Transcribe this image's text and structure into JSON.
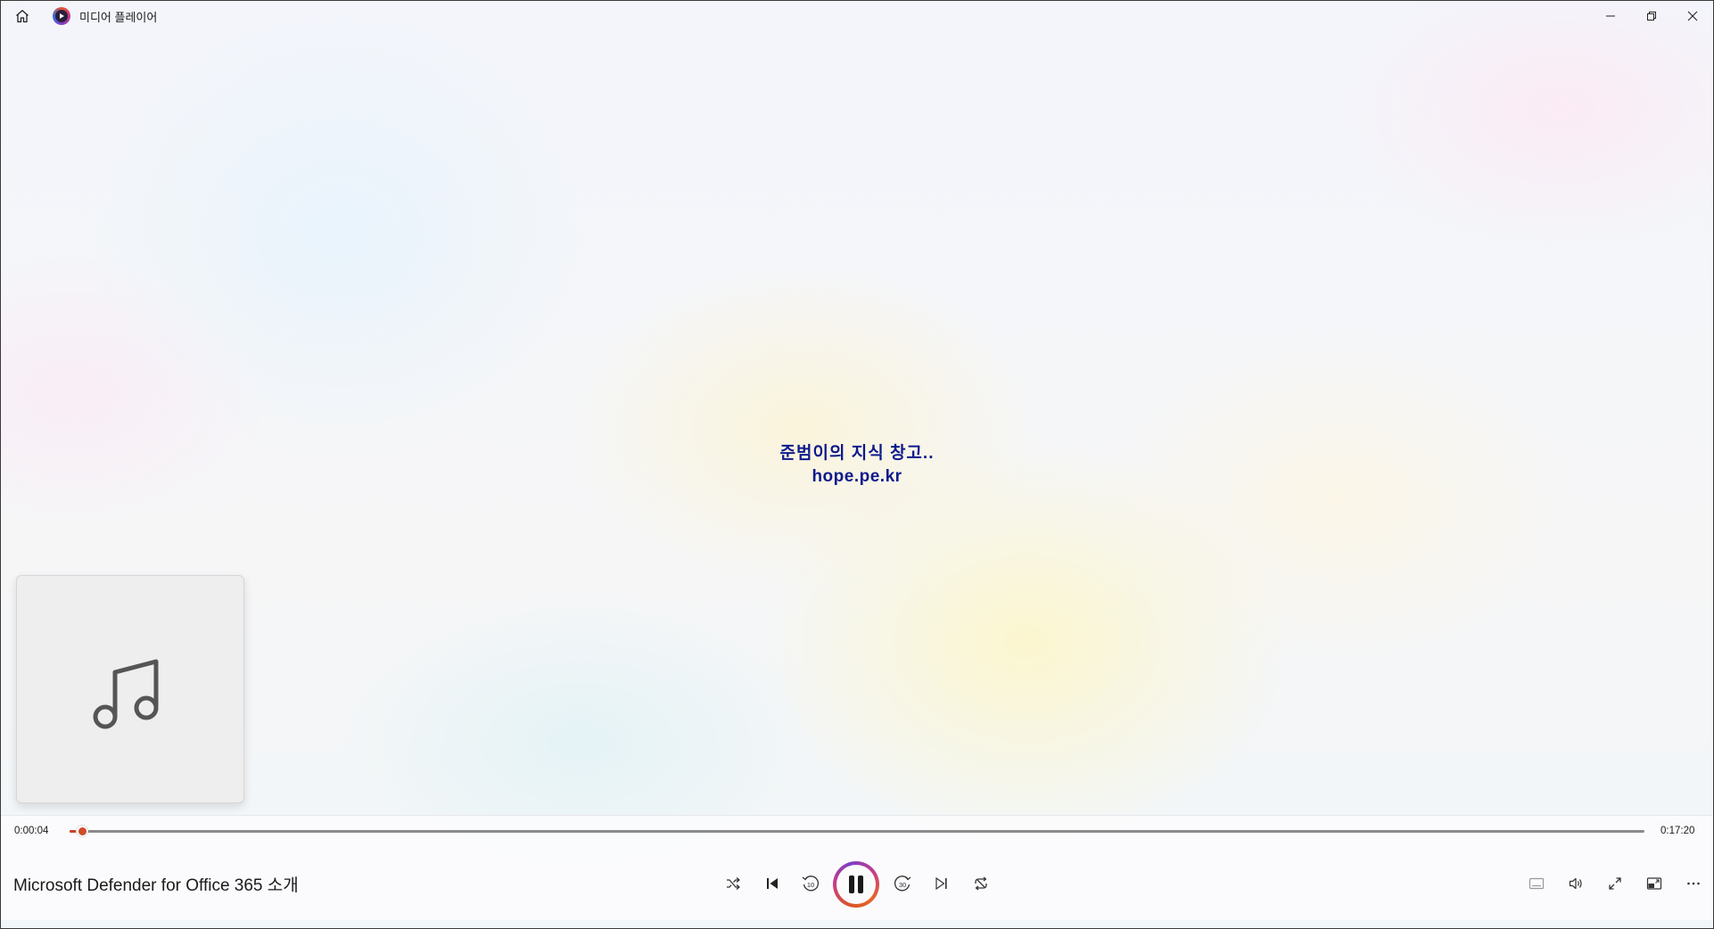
{
  "window": {
    "title": "미디어 플레이어"
  },
  "titlebar_icons": {
    "home": "home-icon",
    "app": "media-player-app-icon",
    "minimize": "minimize-icon",
    "maximize": "restore-icon",
    "close": "close-icon"
  },
  "video": {
    "watermark_line1": "준범이의 지식 창고..",
    "watermark_line2": "hope.pe.kr"
  },
  "album_art": {
    "icon": "music-note-icon"
  },
  "playback": {
    "current_time": "0:00:04",
    "total_time": "0:17:20",
    "progress_fraction": 0.004,
    "track_title": "Microsoft Defender for Office 365 소개",
    "state": "playing"
  },
  "controls": {
    "left": [
      "shuffle-icon",
      "previous-icon",
      "rewind-10-icon",
      "pause-icon",
      "forward-30-icon",
      "next-icon",
      "repeat-icon"
    ],
    "right": [
      "captions-icon",
      "volume-icon",
      "fullscreen-icon",
      "mini-player-icon",
      "more-icon"
    ],
    "rewind_label": "10",
    "forward_label": "30"
  },
  "colors": {
    "accent": "#d04a28",
    "watermark": "#0d1a8c"
  }
}
